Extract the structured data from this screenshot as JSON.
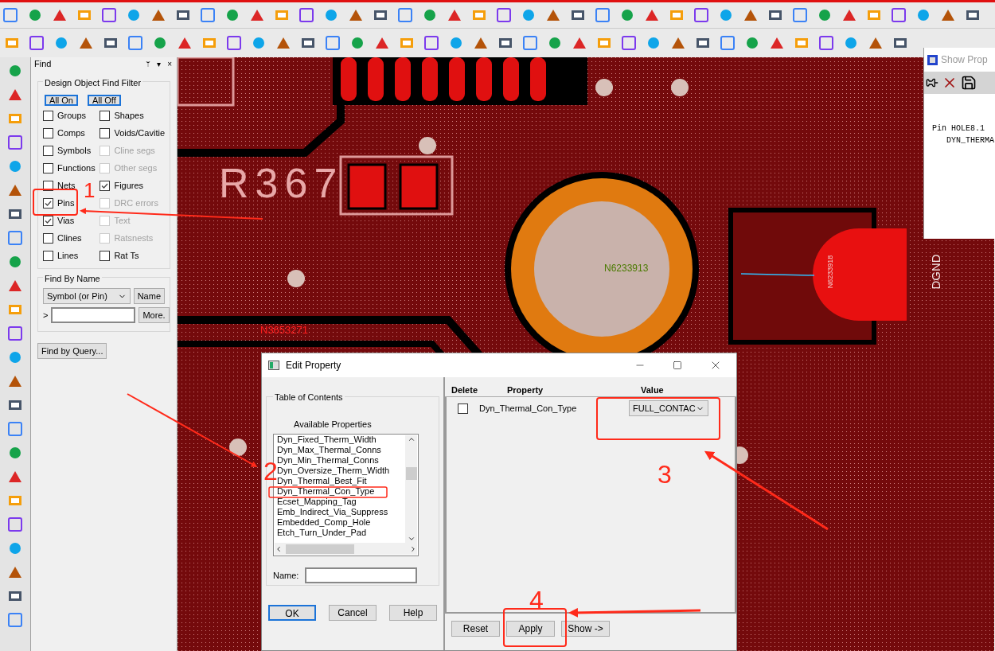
{
  "find_panel": {
    "title": "Find",
    "header_glyphs": [
      "ᛘ",
      "▾",
      "×"
    ],
    "filter_title": "Design Object Find Filter",
    "filter_buttons": [
      "All On",
      "All Off"
    ],
    "left_filters": [
      {
        "label": "Groups",
        "checked": false,
        "disabled": false
      },
      {
        "label": "Comps",
        "checked": false,
        "disabled": false
      },
      {
        "label": "Symbols",
        "checked": false,
        "disabled": false
      },
      {
        "label": "Functions",
        "checked": false,
        "disabled": false
      },
      {
        "label": "Nets",
        "checked": false,
        "disabled": false
      },
      {
        "label": "Pins",
        "checked": true,
        "disabled": false
      },
      {
        "label": "Vias",
        "checked": true,
        "disabled": false
      },
      {
        "label": "Clines",
        "checked": false,
        "disabled": false
      },
      {
        "label": "Lines",
        "checked": false,
        "disabled": false
      }
    ],
    "right_filters": [
      {
        "label": "Shapes",
        "checked": false,
        "disabled": false
      },
      {
        "label": "Voids/Cavitie",
        "checked": false,
        "disabled": false
      },
      {
        "label": "Cline segs",
        "checked": false,
        "disabled": true
      },
      {
        "label": "Other segs",
        "checked": false,
        "disabled": true
      },
      {
        "label": "Figures",
        "checked": true,
        "disabled": false
      },
      {
        "label": "DRC errors",
        "checked": false,
        "disabled": true
      },
      {
        "label": "Text",
        "checked": false,
        "disabled": true
      },
      {
        "label": "Ratsnests",
        "checked": false,
        "disabled": true
      },
      {
        "label": "Rat Ts",
        "checked": false,
        "disabled": false
      }
    ],
    "find_by_name": {
      "title": "Find By Name",
      "type_select": "Symbol (or Pin)",
      "name_button": "Name",
      "prompt": ">",
      "more_button": "More."
    },
    "query_button": "Find by Query..."
  },
  "canvas": {
    "labels": [
      {
        "kind": "refdes",
        "text": "R367"
      },
      {
        "kind": "net",
        "text": "N6233913"
      },
      {
        "kind": "net_red",
        "text": "N3653271"
      },
      {
        "kind": "vertical",
        "text": "N6233918"
      },
      {
        "kind": "vertical_big",
        "text": "DGND"
      }
    ]
  },
  "show_property": {
    "title": "Show Prop",
    "lines": [
      "Pin HOLE8.1",
      "   DYN_THERMA"
    ]
  },
  "dialog": {
    "title": "Edit Property",
    "toc_title": "Table of Contents",
    "available_title": "Available Properties",
    "properties": [
      "Dyn_Fixed_Therm_Width",
      "Dyn_Max_Thermal_Conns",
      "Dyn_Min_Thermal_Conns",
      "Dyn_Oversize_Therm_Width",
      "Dyn_Thermal_Best_Fit",
      "Dyn_Thermal_Con_Type",
      "Ecset_Mapping_Tag",
      "Emb_Indirect_Via_Suppress",
      "Embedded_Comp_Hole",
      "Etch_Turn_Under_Pad"
    ],
    "name_label": "Name:",
    "left_buttons": [
      {
        "label": "OK",
        "default": true
      },
      {
        "label": "Cancel",
        "default": false
      },
      {
        "label": "Help",
        "default": false
      }
    ],
    "columns": [
      "Delete",
      "Property",
      "Value"
    ],
    "rows": [
      {
        "delete": false,
        "property": "Dyn_Thermal_Con_Type",
        "value": "FULL_CONTAC"
      }
    ],
    "right_buttons": [
      "Reset",
      "Apply",
      "Show ->"
    ]
  },
  "annotations": [
    "1",
    "2",
    "3",
    "4"
  ]
}
